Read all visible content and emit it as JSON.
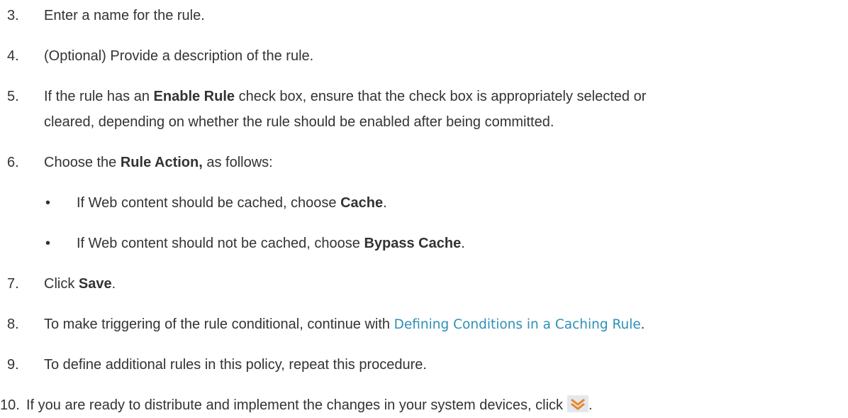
{
  "steps": {
    "s3": {
      "num": "3.",
      "text": "Enter a name for the rule."
    },
    "s4": {
      "num": "4.",
      "text": "(Optional) Provide a description of the rule."
    },
    "s5": {
      "num": "5.",
      "pre": "If the rule has an ",
      "bold": "Enable Rule",
      "post": " check box, ensure that the check box is appropriately selected or",
      "line2": "cleared, depending on whether the rule should be enabled after being committed."
    },
    "s6": {
      "num": "6.",
      "pre": "Choose the ",
      "bold": "Rule Action,",
      "post": " as follows:",
      "bullets": [
        {
          "dot": "•",
          "pre": "If Web content should be cached, choose ",
          "bold": "Cache",
          "post": "."
        },
        {
          "dot": "•",
          "pre": "If Web content should not be cached, choose ",
          "bold": "Bypass Cache",
          "post": "."
        }
      ]
    },
    "s7": {
      "num": "7.",
      "pre": "Click ",
      "bold": "Save",
      "post": "."
    },
    "s8": {
      "num": "8.",
      "pre": "To make triggering of the rule conditional, continue with ",
      "link": "Defining Conditions in a Caching Rule",
      "post": "."
    },
    "s9": {
      "num": "9.",
      "text": "To define additional rules in this policy, repeat this procedure."
    },
    "s10": {
      "num": "10.",
      "pre": "If you are ready to distribute and implement the changes in your system devices, click",
      "icon": "commit-chevrons-icon",
      "post": "."
    }
  },
  "colors": {
    "text": "#333333",
    "link": "#2e8fb6",
    "icon_orange": "#e8862a",
    "icon_bg": "#e3e8ee"
  }
}
